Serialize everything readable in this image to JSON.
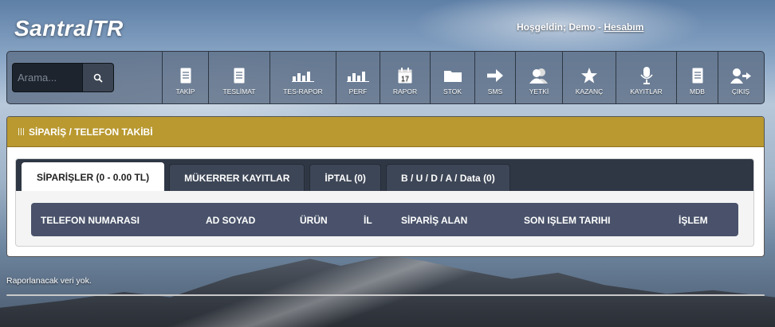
{
  "header": {
    "brand": "SantralTR",
    "welcome_text": "Hoşgeldin; Demo - ",
    "account_link": "Hesabım"
  },
  "search": {
    "placeholder": "Arama..."
  },
  "nav": [
    {
      "label": "TAKİP",
      "icon": "document-icon"
    },
    {
      "label": "TESLİMAT",
      "icon": "document-icon"
    },
    {
      "label": "TES-RAPOR",
      "icon": "bar-chart-icon"
    },
    {
      "label": "PERF",
      "icon": "bar-chart-icon"
    },
    {
      "label": "RAPOR",
      "icon": "calendar-icon"
    },
    {
      "label": "STOK",
      "icon": "folder-icon"
    },
    {
      "label": "SMS",
      "icon": "arrow-right-icon"
    },
    {
      "label": "YETKİ",
      "icon": "users-icon"
    },
    {
      "label": "KAZANÇ",
      "icon": "star-icon"
    },
    {
      "label": "KAYITLAR",
      "icon": "microphone-icon"
    },
    {
      "label": "MDB",
      "icon": "document-icon"
    },
    {
      "label": "ÇIKIŞ",
      "icon": "logout-icon"
    }
  ],
  "calendar_day": "17",
  "panel": {
    "title": "SİPARİŞ / TELEFON TAKİBİ"
  },
  "tabs": [
    {
      "label": "SİPARİŞLER (0 - 0.00 TL)",
      "active": true
    },
    {
      "label": "MÜKERRER KAYITLAR",
      "active": false
    },
    {
      "label": "İPTAL (0)",
      "active": false
    },
    {
      "label": "B / U / D / A / Data (0)",
      "active": false
    }
  ],
  "table": {
    "columns": [
      "TELEFON NUMARASI",
      "AD SOYAD",
      "ÜRÜN",
      "İL",
      "SİPARİŞ ALAN",
      "SON IŞLEM TARIHI",
      "İŞLEM"
    ]
  },
  "empty_message": "Raporlanacak veri yok.",
  "colors": {
    "panel_header": "#b99930",
    "toolbar": "#5f7087",
    "tab_bar": "#2f3745",
    "table_header": "#49526a"
  }
}
